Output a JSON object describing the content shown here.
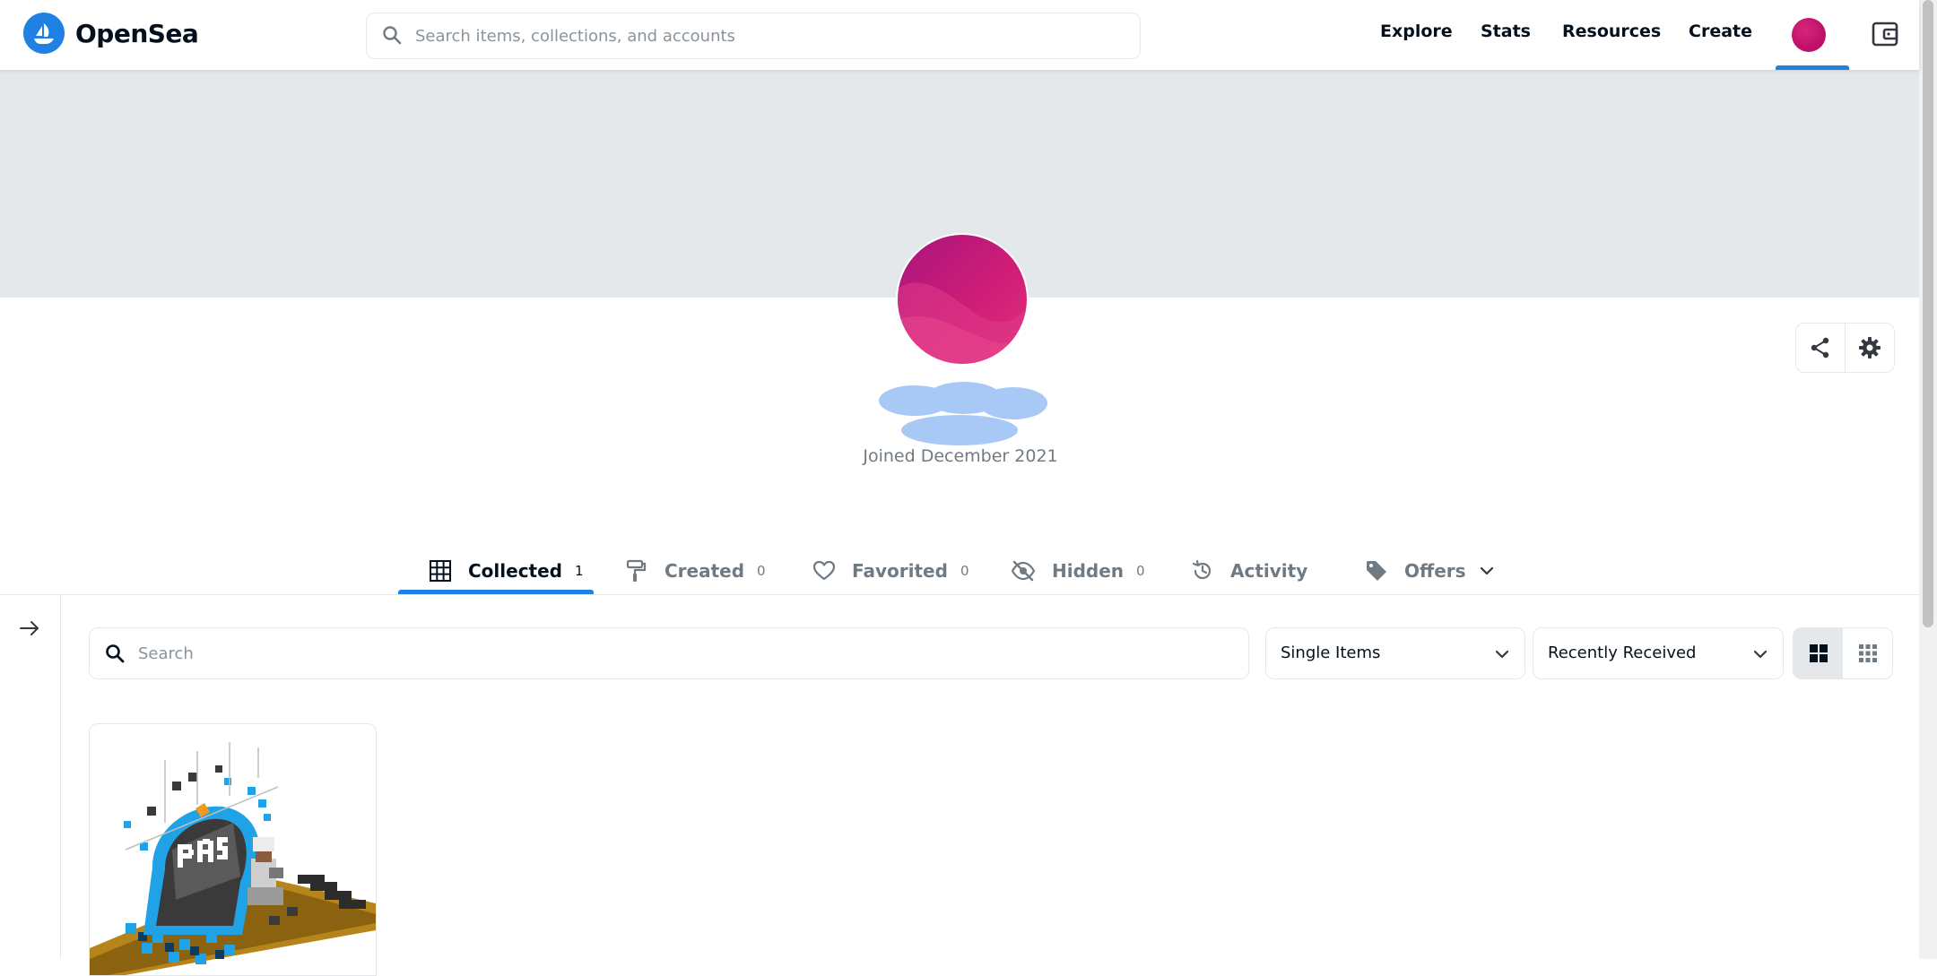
{
  "header": {
    "brand": "OpenSea",
    "search_placeholder": "Search items, collections, and accounts",
    "nav": [
      "Explore",
      "Stats",
      "Resources",
      "Create"
    ],
    "accent_color": "#2081e2"
  },
  "profile": {
    "joined": "Joined December 2021"
  },
  "tabs": [
    {
      "label": "Collected",
      "count": "1",
      "icon": "grid-icon"
    },
    {
      "label": "Created",
      "count": "0",
      "icon": "paint-roller-icon"
    },
    {
      "label": "Favorited",
      "count": "0",
      "icon": "heart-icon"
    },
    {
      "label": "Hidden",
      "count": "0",
      "icon": "eye-off-icon"
    },
    {
      "label": "Activity",
      "icon": "history-icon"
    },
    {
      "label": "Offers",
      "icon": "tag-icon"
    }
  ],
  "filters": {
    "search_placeholder": "Search",
    "item_type": "Single Items",
    "sort": "Recently Received"
  }
}
